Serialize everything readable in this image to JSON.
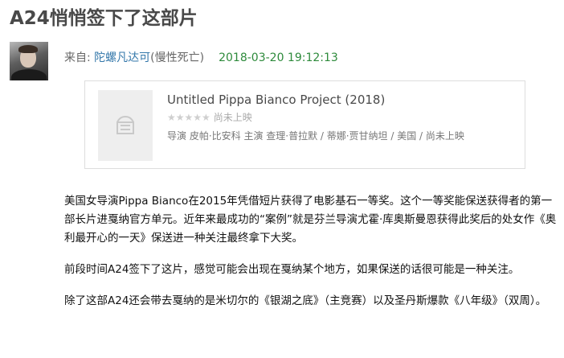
{
  "article": {
    "title": "A24悄悄签下了这部片"
  },
  "byline": {
    "from_label": "来自: ",
    "author_name": "陀螺凡达可",
    "author_note": "(慢性死亡)",
    "timestamp": "2018-03-20 19:12:13"
  },
  "movie_card": {
    "title": "Untitled Pippa Bianco Project (2018)",
    "stars": "★★★★★",
    "rating_status": "尚未上映",
    "meta": "导演 皮帕·比安科 主演 查理·普拉默 / 蒂娜·贾甘纳坦 / 美国 / 尚未上映",
    "poster_icon": "ticket-icon"
  },
  "body": {
    "paragraphs": [
      "美国女导演Pippa Bianco在2015年凭借短片获得了电影基石一等奖。这个一等奖能保送获得者的第一部长片进戛纳官方单元。近年来最成功的“案例”就是芬兰导演尤霍·库奥斯曼恩获得此奖后的处女作《奥利最开心的一天》保送进一种关注最终拿下大奖。",
      "前段时间A24签下了这片，感觉可能会出现在戛纳某个地方，如果保送的话很可能是一种关注。",
      "除了这部A24还会带去戛纳的是米切尔的《银湖之底》（主竞赛）以及圣丹斯爆款《八年级》（双周）。"
    ]
  },
  "colors": {
    "link": "#3377aa",
    "timestamp": "#2d8a3b",
    "title": "#494949"
  }
}
